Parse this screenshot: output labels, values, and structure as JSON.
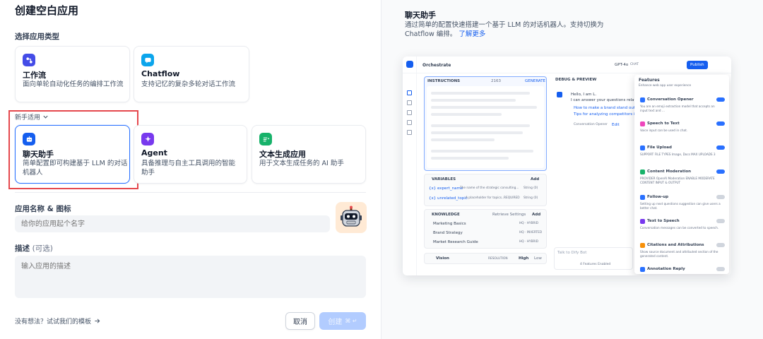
{
  "page": {
    "title": "创建空白应用"
  },
  "app_type": {
    "label": "选择应用类型",
    "primary_cards": [
      {
        "name": "工作流",
        "desc": "面向单轮自动化任务的编排工作流"
      },
      {
        "name": "Chatflow",
        "desc": "支持记忆的复杂多轮对话工作流"
      }
    ],
    "beginner_toggle": "新手适用",
    "beginner_cards": [
      {
        "name": "聊天助手",
        "desc": "简单配置即可构建基于 LLM 的对话机器人"
      },
      {
        "name": "Agent",
        "desc": "具备推理与自主工具调用的智能助手"
      },
      {
        "name": "文本生成应用",
        "desc": "用于文本生成任务的 AI 助手"
      }
    ]
  },
  "name_icon": {
    "label": "应用名称 & 图标",
    "placeholder": "给你的应用起个名字"
  },
  "description": {
    "label": "描述",
    "optional": "(可选)",
    "placeholder": "输入应用的描述"
  },
  "footer": {
    "template_link": "没有想法？试试我们的模板",
    "cancel": "取消",
    "create": "创建"
  },
  "preview_panel": {
    "title": "聊天助手",
    "desc": "通过简单的配置快速搭建一个基于 LLM 的对话机器人。支持切换为 Chatflow 编排。",
    "learn_more": "了解更多",
    "screenshot": {
      "header": "Orchestrate",
      "model": "GPT-4o",
      "mode": "CHAT",
      "publish": "Publish",
      "instructions": "INSTRUCTIONS",
      "instructions_count": "2163",
      "generate": "GENERATE",
      "debug": "DEBUG & PREVIEW",
      "chat_greeting": "Hello, I am L.",
      "chat_line2": "I can answer your questions related",
      "chat_q1": "How to make a brand stand out?",
      "chat_q2": "Tips for analyzing competitors in marketing",
      "opener": "Conversation Opener",
      "opener_edit": "Edit",
      "variables": "VARIABLES",
      "add": "Add",
      "var_rows": [
        {
          "key": "{x} expert_name",
          "desc": "The name of the strategic consulting...",
          "type": "String (0)"
        },
        {
          "key": "{x} unrelated_topic",
          "desc": "A placeholder for topics...",
          "req": "REQUIRED",
          "type": "String (0)"
        }
      ],
      "knowledge": "KNOWLEDGE",
      "retrieve": "Retrieve Settings",
      "kb_rows": [
        {
          "name": "Marketing Basics",
          "tag": "HQ · HYBRID"
        },
        {
          "name": "Brand Strategy",
          "tag": "HQ · INVERTED"
        },
        {
          "name": "Market Research Guide",
          "tag": "HQ · HYBRID"
        }
      ],
      "vision": "Vision",
      "resolution": "RESOLUTION",
      "high": "High",
      "low": "Low",
      "chat_input": "Talk to Dify Bot",
      "features_enabled": "4 Features Enabled",
      "features_title": "Features",
      "features_sub": "Enhance web app user experience",
      "features": [
        {
          "name": "Conversation Opener",
          "desc": "You are an emoji extraction model that accepts an input text and ...",
          "on": true
        },
        {
          "name": "Speech to Text",
          "desc": "Voice input can be used in chat.",
          "on": true
        },
        {
          "name": "File Upload",
          "desc": "SUPPORT FILE TYPES  Image, Docs    MAX UPLOADS 3",
          "on": true
        },
        {
          "name": "Content Moderation",
          "desc": "PROVIDER OpenAI Moderation   ENABLE MODERATE CONTENT INPUT & OUTPUT",
          "on": true
        },
        {
          "name": "Follow-up",
          "desc": "Setting up next questions suggestion can give users a better chat.",
          "on": false
        },
        {
          "name": "Text to Speech",
          "desc": "Conversation messages can be converted to speech.",
          "on": false
        },
        {
          "name": "Citations and Attributions",
          "desc": "Show source document and attributed section of the generated content.",
          "on": false
        },
        {
          "name": "Annotation Reply",
          "desc": "",
          "on": false
        }
      ]
    }
  },
  "colors": {
    "accent": "#2970ff",
    "highlight": "#e5484d"
  }
}
